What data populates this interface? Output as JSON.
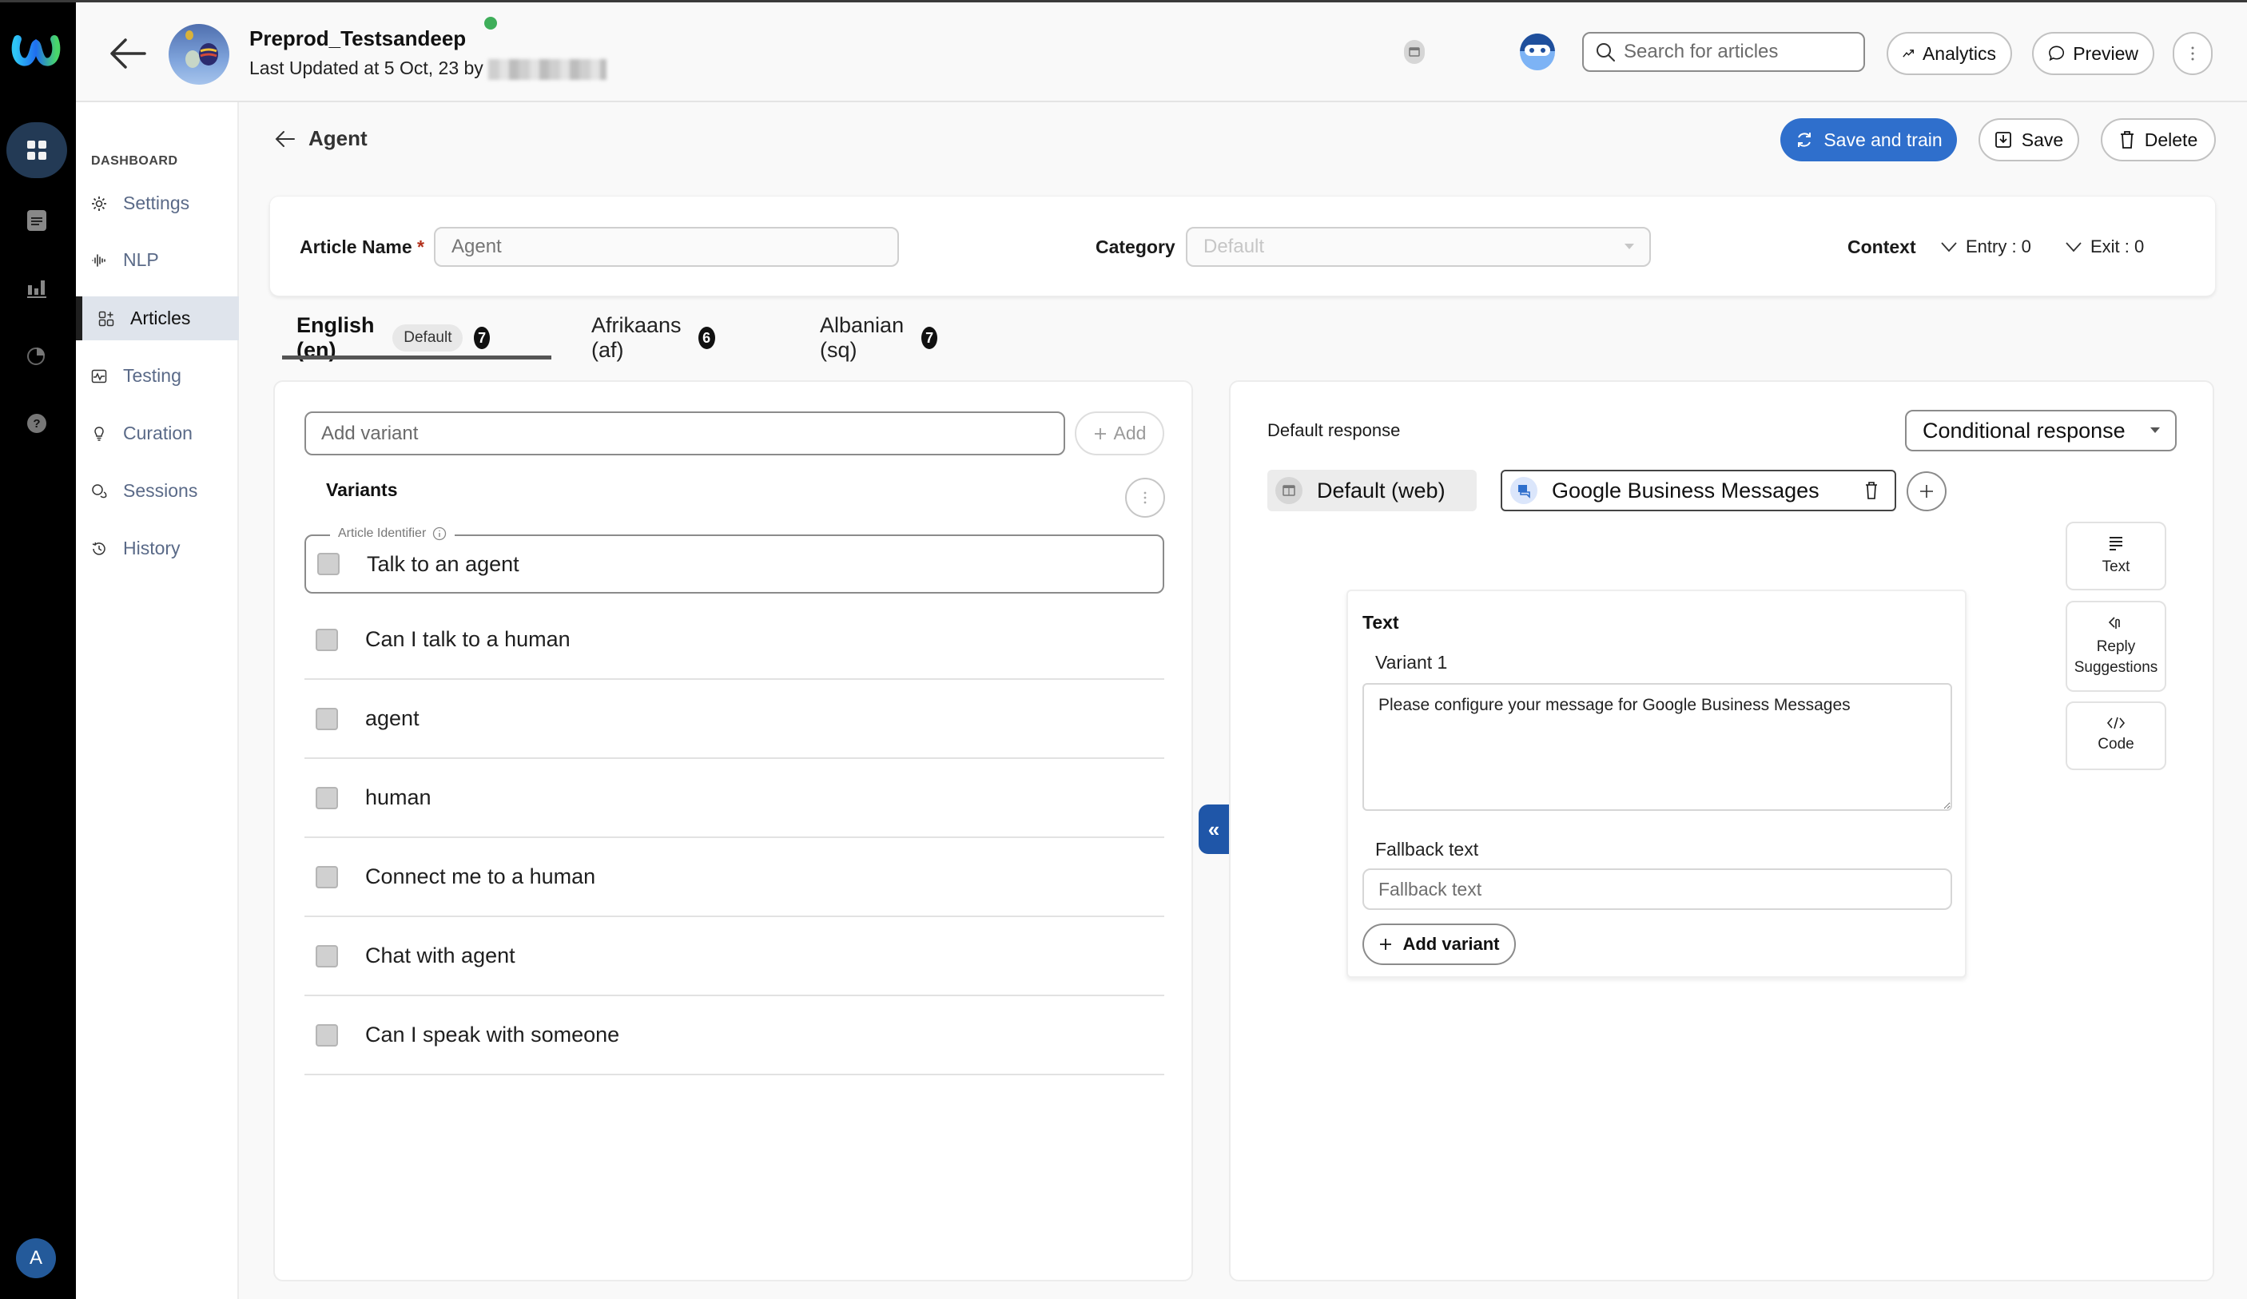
{
  "app": {
    "bot_name": "Preprod_Testsandeep",
    "last_updated": "Last Updated at 5 Oct, 23 by",
    "status_color": "#3fae5a",
    "accent_color": "#2f6fcc"
  },
  "rail": {
    "items": [
      {
        "icon": "dashboard-grid-icon",
        "active": true
      },
      {
        "icon": "document-icon",
        "active": false
      },
      {
        "icon": "bar-chart-icon",
        "active": false
      },
      {
        "icon": "pie-chart-icon",
        "active": false
      },
      {
        "icon": "help-icon",
        "active": false
      }
    ],
    "user_initial": "A"
  },
  "header": {
    "search_placeholder": "Search for articles",
    "analytics_label": "Analytics",
    "preview_label": "Preview",
    "more_icon": "kebab-icon"
  },
  "sidebar": {
    "section_label": "DASHBOARD",
    "items": [
      {
        "label": "Settings",
        "icon": "gear-icon"
      },
      {
        "label": "NLP",
        "icon": "waveform-icon"
      },
      {
        "label": "Articles",
        "icon": "articles-icon",
        "active": true
      },
      {
        "label": "Testing",
        "icon": "testing-icon"
      },
      {
        "label": "Curation",
        "icon": "lightbulb-icon"
      },
      {
        "label": "Sessions",
        "icon": "chat-bubbles-icon"
      },
      {
        "label": "History",
        "icon": "history-icon"
      }
    ]
  },
  "page": {
    "title": "Agent",
    "save_and_train_label": "Save and train",
    "save_label": "Save",
    "delete_label": "Delete"
  },
  "meta": {
    "article_name_label": "Article Name",
    "required_mark": "*",
    "article_name_placeholder": "Agent",
    "category_label": "Category",
    "category_placeholder": "Default",
    "context_label": "Context",
    "entry_label": "Entry : 0",
    "exit_label": "Exit : 0"
  },
  "tabs": [
    {
      "label": "English (en)",
      "chip": "Default",
      "count": "7",
      "active": true
    },
    {
      "label": "Afrikaans (af)",
      "count": "6"
    },
    {
      "label": "Albanian (sq)",
      "count": "7"
    }
  ],
  "variants_panel": {
    "add_placeholder": "Add variant",
    "add_label": "Add",
    "title": "Variants",
    "identifier_legend": "Article Identifier",
    "rows": [
      "Talk to an agent",
      "Can I talk to a human",
      "agent",
      "human",
      "Connect me to a human",
      "Chat with agent",
      "Can I speak with someone"
    ]
  },
  "response_panel": {
    "default_response_label": "Default response",
    "response_type": "Conditional response",
    "channels": [
      {
        "label": "Default (web)",
        "icon": "web-channel-icon"
      },
      {
        "label": "Google Business Messages",
        "icon": "gbm-channel-icon",
        "active": true
      }
    ],
    "tools": [
      {
        "label": "Text",
        "icon": "text-lines-icon"
      },
      {
        "label": "Reply Suggestions",
        "icon": "tap-icon"
      },
      {
        "label": "Code",
        "icon": "code-icon"
      }
    ],
    "text_card": {
      "title": "Text",
      "variant_label": "Variant 1",
      "variant_value": "Please configure your message for Google Business Messages",
      "fallback_label": "Fallback text",
      "fallback_placeholder": "Fallback text",
      "add_variant_label": "Add variant"
    }
  },
  "collapse_toggle": "«"
}
